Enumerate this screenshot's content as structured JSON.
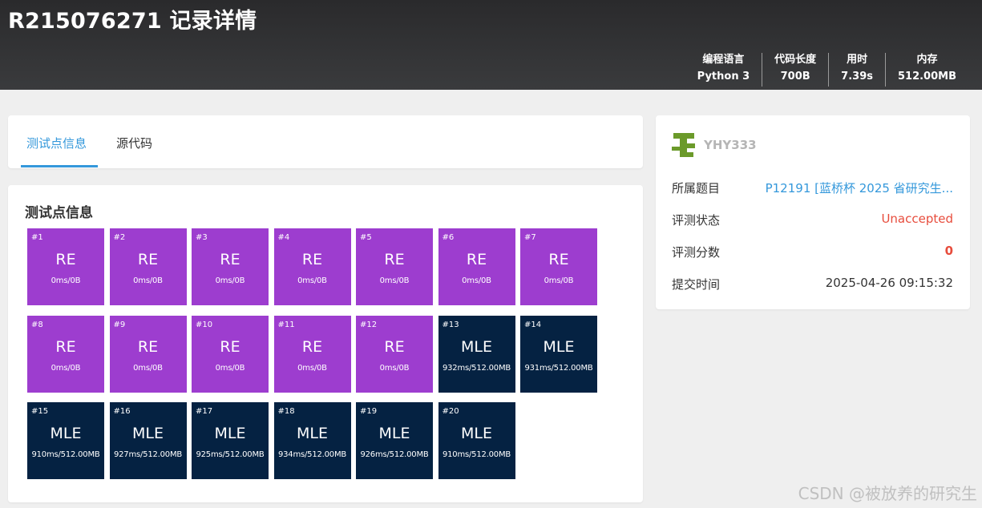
{
  "header": {
    "title": "R215076271 记录详情",
    "stats": [
      {
        "label": "编程语言",
        "value": "Python 3"
      },
      {
        "label": "代码长度",
        "value": "700B"
      },
      {
        "label": "用时",
        "value": "7.39s"
      },
      {
        "label": "内存",
        "value": "512.00MB"
      }
    ]
  },
  "tabs": {
    "testcases": "测试点信息",
    "source": "源代码"
  },
  "main": {
    "section_title": "测试点信息",
    "testcases": [
      {
        "num": "#1",
        "status": "RE",
        "info": "0ms/0B"
      },
      {
        "num": "#2",
        "status": "RE",
        "info": "0ms/0B"
      },
      {
        "num": "#3",
        "status": "RE",
        "info": "0ms/0B"
      },
      {
        "num": "#4",
        "status": "RE",
        "info": "0ms/0B"
      },
      {
        "num": "#5",
        "status": "RE",
        "info": "0ms/0B"
      },
      {
        "num": "#6",
        "status": "RE",
        "info": "0ms/0B"
      },
      {
        "num": "#7",
        "status": "RE",
        "info": "0ms/0B"
      },
      {
        "num": "#8",
        "status": "RE",
        "info": "0ms/0B"
      },
      {
        "num": "#9",
        "status": "RE",
        "info": "0ms/0B"
      },
      {
        "num": "#10",
        "status": "RE",
        "info": "0ms/0B"
      },
      {
        "num": "#11",
        "status": "RE",
        "info": "0ms/0B"
      },
      {
        "num": "#12",
        "status": "RE",
        "info": "0ms/0B"
      },
      {
        "num": "#13",
        "status": "MLE",
        "info": "932ms/512.00MB"
      },
      {
        "num": "#14",
        "status": "MLE",
        "info": "931ms/512.00MB"
      },
      {
        "num": "#15",
        "status": "MLE",
        "info": "910ms/512.00MB"
      },
      {
        "num": "#16",
        "status": "MLE",
        "info": "927ms/512.00MB"
      },
      {
        "num": "#17",
        "status": "MLE",
        "info": "925ms/512.00MB"
      },
      {
        "num": "#18",
        "status": "MLE",
        "info": "934ms/512.00MB"
      },
      {
        "num": "#19",
        "status": "MLE",
        "info": "926ms/512.00MB"
      },
      {
        "num": "#20",
        "status": "MLE",
        "info": "910ms/512.00MB"
      }
    ]
  },
  "colors": {
    "RE": "#9d3dcf",
    "MLE": "#052242",
    "accent": "#3498db",
    "error": "#e74c3c",
    "avatar": "#6b9a2a"
  },
  "sidebar": {
    "username": "YHY333",
    "problem_label": "所属题目",
    "problem_value": "P12191 [蓝桥杯 2025 省研究生...",
    "status_label": "评测状态",
    "status_value": "Unaccepted",
    "score_label": "评测分数",
    "score_value": "0",
    "time_label": "提交时间",
    "time_value": "2025-04-26 09:15:32"
  },
  "watermark": "CSDN @被放养的研究生"
}
